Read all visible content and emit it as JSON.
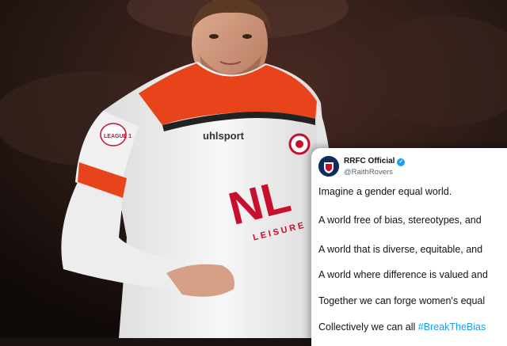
{
  "tweet": {
    "account_name": "RRFC Official",
    "handle": "@RaithRovers",
    "verified_icon": "verified-badge-icon",
    "lines": [
      "Imagine a gender equal world.",
      "A world free of bias, stereotypes, and",
      "A world that is diverse, equitable, and",
      "A world where difference is valued and",
      "Together we can forge women's equal",
      "Collectively we can all"
    ],
    "hashtag": "#BreakTheBias"
  },
  "photo": {
    "shirt_sponsor": "NL",
    "shirt_sponsor_sub": "LEISURE",
    "kit_brand": "uhlsport",
    "sleeve_badge": "LEAGUE 1"
  },
  "colors": {
    "shirt": "#f4f4f4",
    "shirt_accent": "#e8441c",
    "shirt_red": "#c8102e",
    "background": "#1a1210",
    "hashtag": "#1d9bf0"
  }
}
